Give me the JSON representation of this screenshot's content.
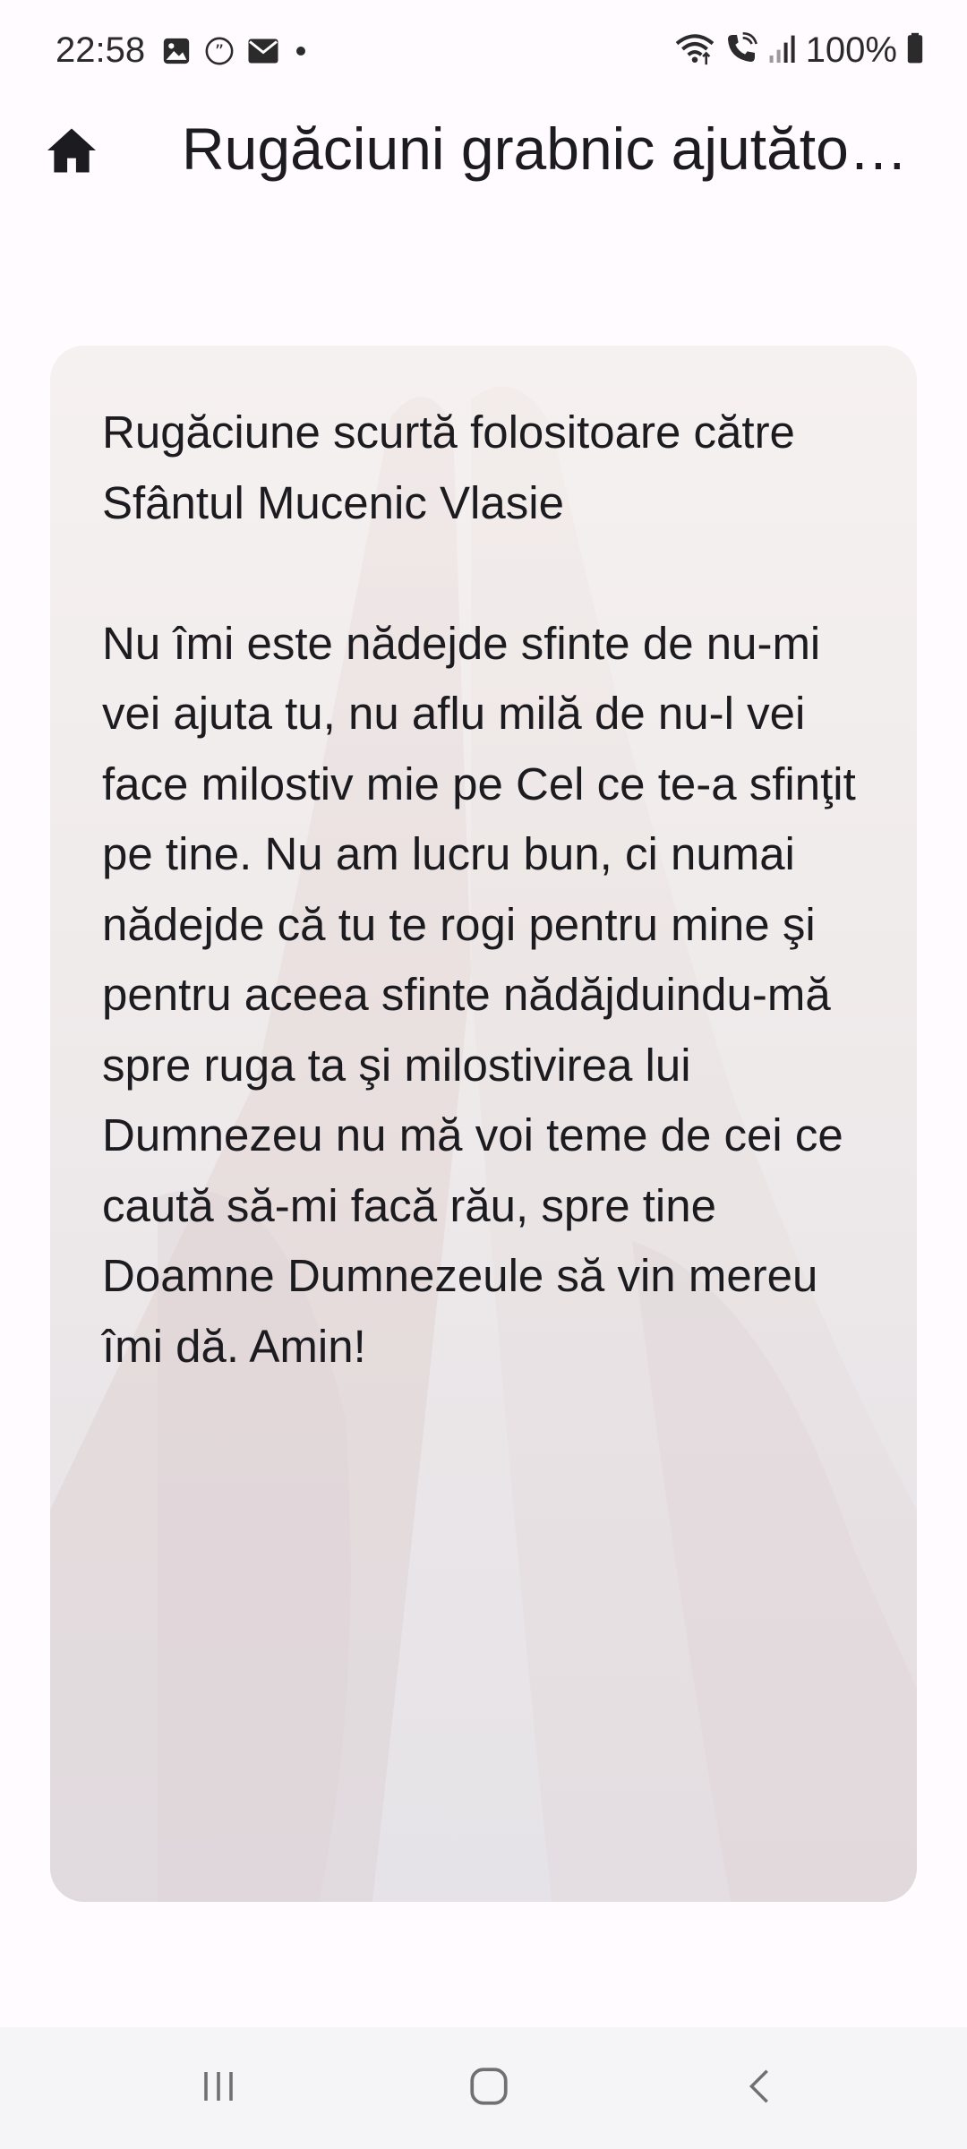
{
  "status_bar": {
    "time": "22:58",
    "left_icons": [
      "image-icon",
      "quote-icon",
      "mail-icon",
      "dot-icon"
    ],
    "right_icons": [
      "wifi-icon",
      "wifi-call-icon",
      "signal-icon",
      "battery-icon"
    ],
    "battery": "100%"
  },
  "app_bar": {
    "title": "Rugăciuni grabnic ajutătoare",
    "home_icon": "home-icon"
  },
  "card": {
    "text": "Rugăciune scurtă folositoare către Sfântul Mucenic Vlasie\n\nNu îmi este nădejde sfinte de nu-mi vei ajuta tu, nu aflu milă de nu-l vei face milostiv mie pe Cel ce te-a sfinţit pe tine. Nu am lucru bun, ci numai nădejde că tu te rogi pentru mine şi pentru aceea sfinte nădăjduindu-mă spre ruga ta şi milostivirea lui Dumnezeu nu mă voi teme de cei ce caută să-mi facă rău, spre tine Doamne Dumnezeule să vin mereu îmi dă. Amin!"
  },
  "nav_bar": {
    "buttons": [
      "recents-icon",
      "home-nav-icon",
      "back-icon"
    ]
  }
}
